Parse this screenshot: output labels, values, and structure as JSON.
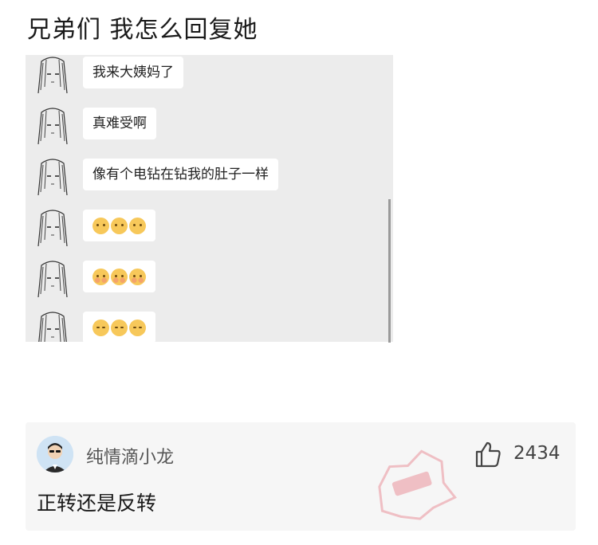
{
  "post": {
    "title": "兄弟们 我怎么回复她"
  },
  "chat": {
    "messages": [
      {
        "type": "text",
        "text": "我来大姨妈了"
      },
      {
        "type": "text",
        "text": "真难受啊"
      },
      {
        "type": "text",
        "text": "像有个电钻在钻我的肚子一样"
      },
      {
        "type": "emoji",
        "emojis": [
          "awkward-face-icon",
          "awkward-face-icon",
          "awkward-face-icon"
        ]
      },
      {
        "type": "emoji",
        "emojis": [
          "blush-face-icon",
          "blush-face-icon",
          "blush-face-icon"
        ]
      },
      {
        "type": "emoji",
        "emojis": [
          "crying-face-icon",
          "crying-face-icon",
          "crying-face-icon"
        ]
      }
    ]
  },
  "comment": {
    "username": "纯情滴小龙",
    "text": "正转还是反转",
    "like_count": "2434",
    "avatar_icon": "sunglasses-man-avatar",
    "like_icon": "thumbs-up-icon"
  },
  "colors": {
    "chat_bg": "#ececec",
    "bubble_bg": "#ffffff",
    "card_bg": "#f6f6f6",
    "stamp": "#e45a6a"
  }
}
